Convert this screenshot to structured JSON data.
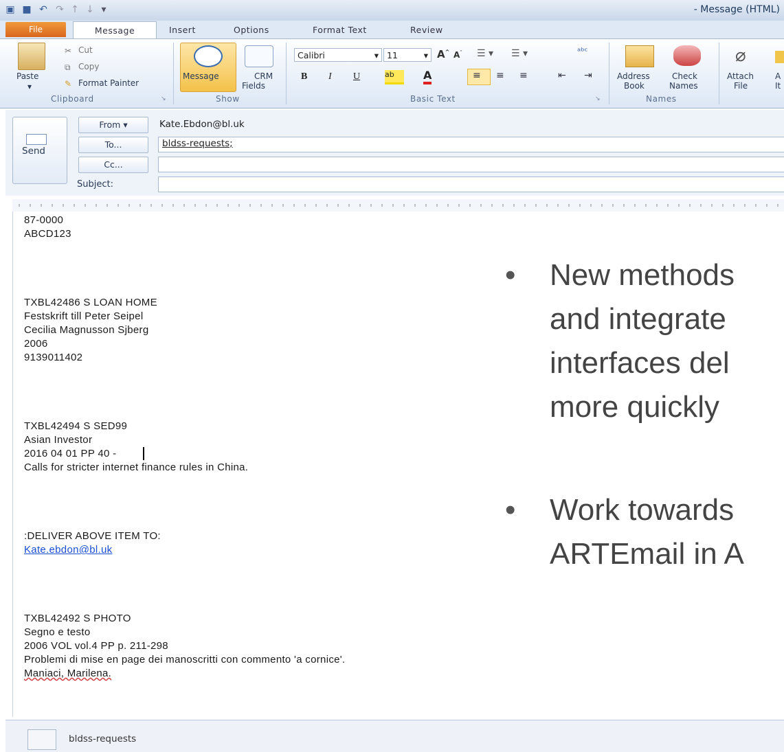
{
  "window": {
    "title": "- Message (HTML)"
  },
  "tabs": [
    "File",
    "Message",
    "Insert",
    "Options",
    "Format Text",
    "Review"
  ],
  "ribbon": {
    "clipboard": {
      "paste": "Paste",
      "cut": "Cut",
      "copy": "Copy",
      "format_painter": "Format Painter",
      "label": "Clipboard"
    },
    "show": {
      "message": "Message",
      "crm1": "CRM",
      "crm2": "Fields",
      "label": "Show"
    },
    "basic_text": {
      "font": "Calibri",
      "size": "11",
      "label": "Basic Text",
      "bold": "B",
      "italic": "I",
      "underline": "U"
    },
    "names": {
      "address1": "Address",
      "address2": "Book",
      "check1": "Check",
      "check2": "Names",
      "label": "Names"
    },
    "include": {
      "attach1": "Attach",
      "attach2": "File",
      "item1": "A",
      "item2": "It"
    }
  },
  "compose": {
    "send": "Send",
    "from_label": "From",
    "from_value": "Kate.Ebdon@bl.uk",
    "to_label": "To...",
    "to_value": "bldss-requests;",
    "cc_label": "Cc...",
    "subject_label": "Subject:"
  },
  "body": {
    "lines": [
      "87-0000",
      "ABCD123",
      "TXBL42486 S LOAN HOME",
      "Festskrift till Peter Seipel",
      "Cecilia Magnusson Sjberg",
      "2006",
      "9139011402",
      "TXBL42494 S SED99",
      "Asian Investor",
      "2016 04 01 PP 40 -",
      "Calls for stricter internet finance rules in China.",
      ":DELIVER ABOVE ITEM TO:",
      "Kate.ebdon@bl.uk",
      "TXBL42492 S PHOTO",
      "Segno e testo",
      "2006 VOL vol.4 PP p. 211-298",
      "Problemi di mise en page dei manoscritti con commento 'a cornice'.",
      "Maniaci, Marilena."
    ]
  },
  "overlay": {
    "bullet1": [
      "New methods",
      "and integrate",
      "interfaces del",
      "more quickly"
    ],
    "bullet2": [
      "Work towards",
      "ARTEmail in A"
    ]
  },
  "status": {
    "contact": "bldss-requests"
  }
}
